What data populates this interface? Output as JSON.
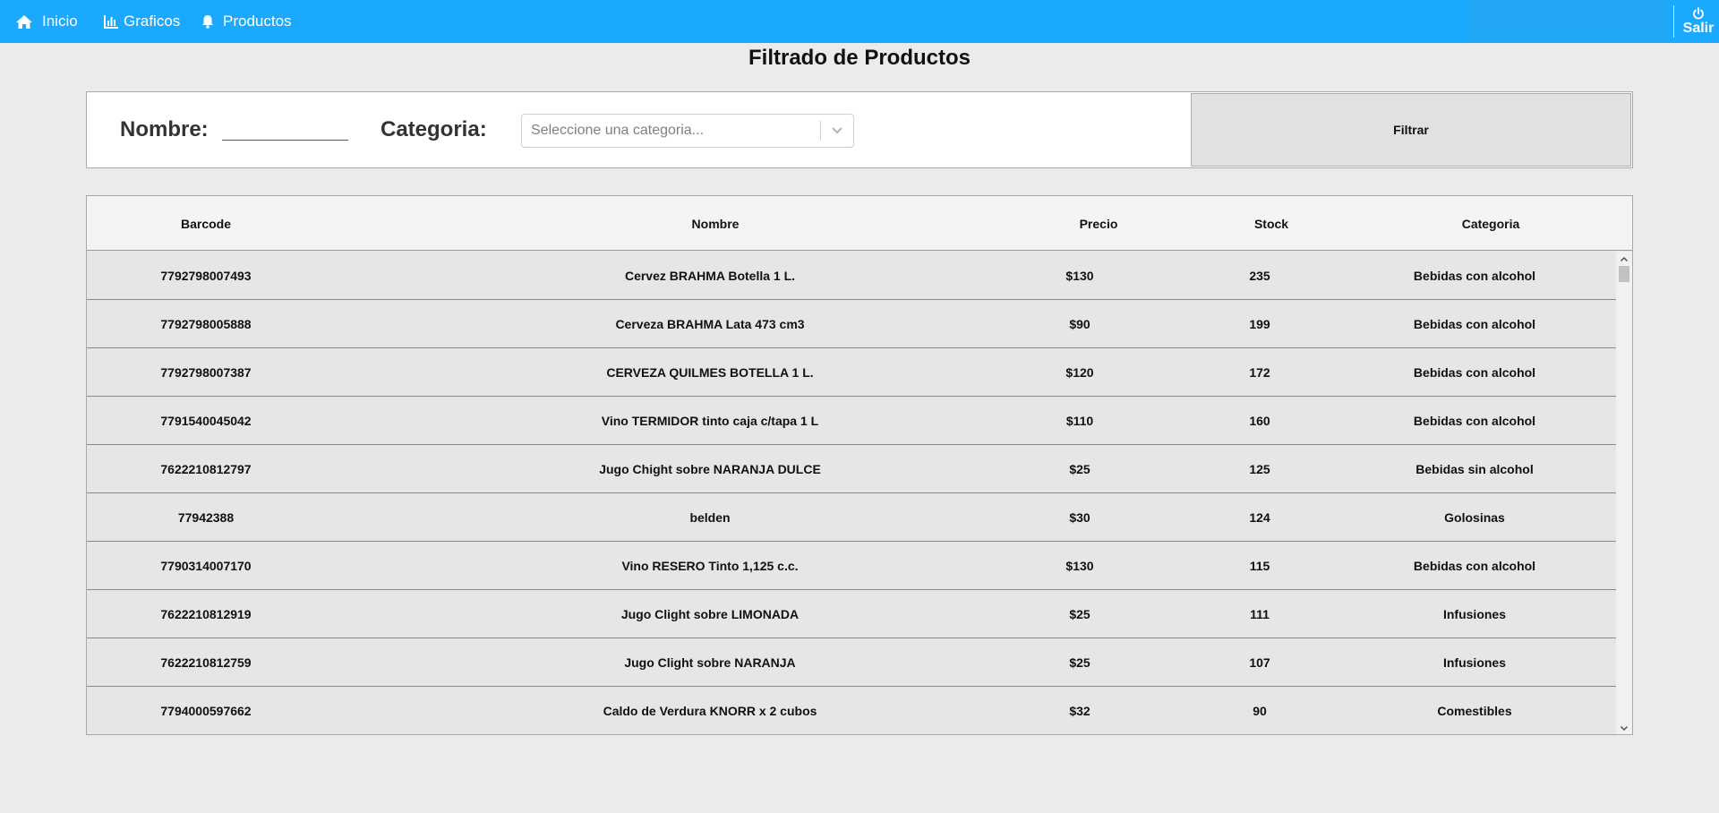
{
  "nav": {
    "items": [
      {
        "label": "Inicio",
        "icon": "home-icon"
      },
      {
        "label": "Graficos",
        "icon": "bar-chart-icon"
      },
      {
        "label": "Productos",
        "icon": "bell-icon"
      }
    ],
    "logout_label": "Salir",
    "logout_icon": "power-icon",
    "accent_color": "#1ba9fd"
  },
  "page": {
    "title": "Filtrado de Productos"
  },
  "filter": {
    "nombre_label": "Nombre:",
    "nombre_value": "",
    "categoria_label": "Categoria:",
    "categoria_placeholder": "Seleccione una categoria...",
    "button_label": "Filtrar"
  },
  "table": {
    "columns": [
      "Barcode",
      "Nombre",
      "Precio",
      "Stock",
      "Categoria"
    ],
    "rows": [
      [
        "7792798007493",
        "Cervez BRAHMA Botella 1 L.",
        "$130",
        "235",
        "Bebidas con alcohol"
      ],
      [
        "7792798005888",
        "Cerveza BRAHMA Lata 473 cm3",
        "$90",
        "199",
        "Bebidas con alcohol"
      ],
      [
        "7792798007387",
        "CERVEZA QUILMES BOTELLA 1 L.",
        "$120",
        "172",
        "Bebidas con alcohol"
      ],
      [
        "7791540045042",
        "Vino TERMIDOR tinto caja c/tapa 1 L",
        "$110",
        "160",
        "Bebidas con alcohol"
      ],
      [
        "7622210812797",
        "Jugo Chight sobre NARANJA DULCE",
        "$25",
        "125",
        "Bebidas sin alcohol"
      ],
      [
        "77942388",
        "belden",
        "$30",
        "124",
        "Golosinas"
      ],
      [
        "7790314007170",
        "Vino RESERO Tinto 1,125 c.c.",
        "$130",
        "115",
        "Bebidas con alcohol"
      ],
      [
        "7622210812919",
        "Jugo Clight sobre LIMONADA",
        "$25",
        "111",
        "Infusiones"
      ],
      [
        "7622210812759",
        "Jugo Clight sobre NARANJA",
        "$25",
        "107",
        "Infusiones"
      ],
      [
        "7794000597662",
        "Caldo de Verdura KNORR x 2 cubos",
        "$32",
        "90",
        "Comestibles"
      ]
    ]
  }
}
